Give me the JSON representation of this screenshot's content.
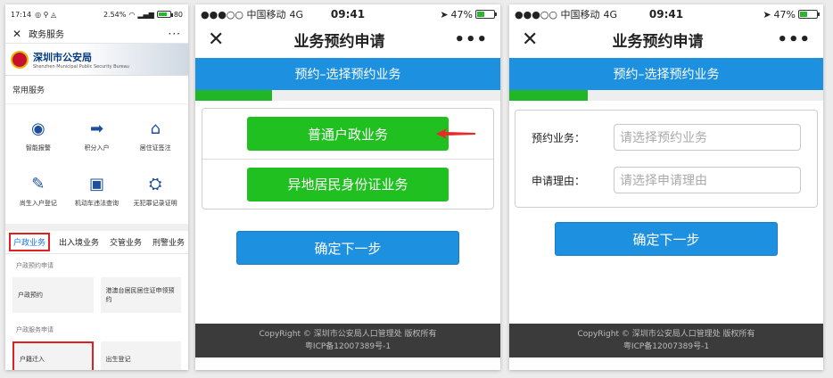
{
  "phone1": {
    "status": {
      "time": "17:14",
      "icons_left": "◎ ⚲ ◬",
      "right": "2.54%",
      "battery": "80"
    },
    "nav": {
      "close": "✕",
      "title": "政务服务",
      "more": "···"
    },
    "banner": {
      "name": "深圳市公安局",
      "sub": "Shenzhen Municipal Public Security Bureau"
    },
    "section_title": "常用服务",
    "services": [
      {
        "label": "智能报警",
        "icon": "alarm-icon"
      },
      {
        "label": "积分入户",
        "icon": "points-icon"
      },
      {
        "label": "居住证签注",
        "icon": "residence-icon"
      },
      {
        "label": "尚生入户登记",
        "icon": "birth-icon"
      },
      {
        "label": "机动车违法查询",
        "icon": "car-icon"
      },
      {
        "label": "无犯罪记录证明",
        "icon": "certificate-icon"
      }
    ],
    "tabs": [
      "户政业务",
      "出入境业务",
      "交管业务",
      "刑警业务"
    ],
    "group1": {
      "title": "户政预约申请",
      "cards": [
        "户政预约",
        "港澳台居民居住证申领预约"
      ]
    },
    "group2": {
      "title": "户政服务申请",
      "cards": [
        "户籍迁入",
        "出生登记"
      ]
    }
  },
  "phone2": {
    "status": {
      "carrier": "●●●○○ 中国移动",
      "network": "4G",
      "time": "09:41",
      "battery_pct": "47%",
      "battery_level": 0.47
    },
    "nav": {
      "close": "✕",
      "title": "业务预约申请",
      "more": "•••"
    },
    "subtitle": "预约–选择预约业务",
    "progress": 0.25,
    "options": [
      "普通户政业务",
      "异地居民身份证业务"
    ],
    "next_button": "确定下一步",
    "footer": {
      "line1": "CopyRight © 深圳市公安局人口管理处 版权所有",
      "line2": "粤ICP备12007389号-1"
    }
  },
  "phone3": {
    "status": {
      "carrier": "●●●○○ 中国移动",
      "network": "4G",
      "time": "09:41",
      "battery_pct": "47%",
      "battery_level": 0.47
    },
    "nav": {
      "close": "✕",
      "title": "业务预约申请",
      "more": "•••"
    },
    "subtitle": "预约–选择预约业务",
    "progress": 0.25,
    "fields": [
      {
        "label": "预约业务：",
        "placeholder": "请选择预约业务"
      },
      {
        "label": "申请理由：",
        "placeholder": "请选择申请理由"
      }
    ],
    "next_button": "确定下一步",
    "footer": {
      "line1": "CopyRight © 深圳市公安局人口管理处 版权所有",
      "line2": "粤ICP备12007389号-1"
    }
  }
}
